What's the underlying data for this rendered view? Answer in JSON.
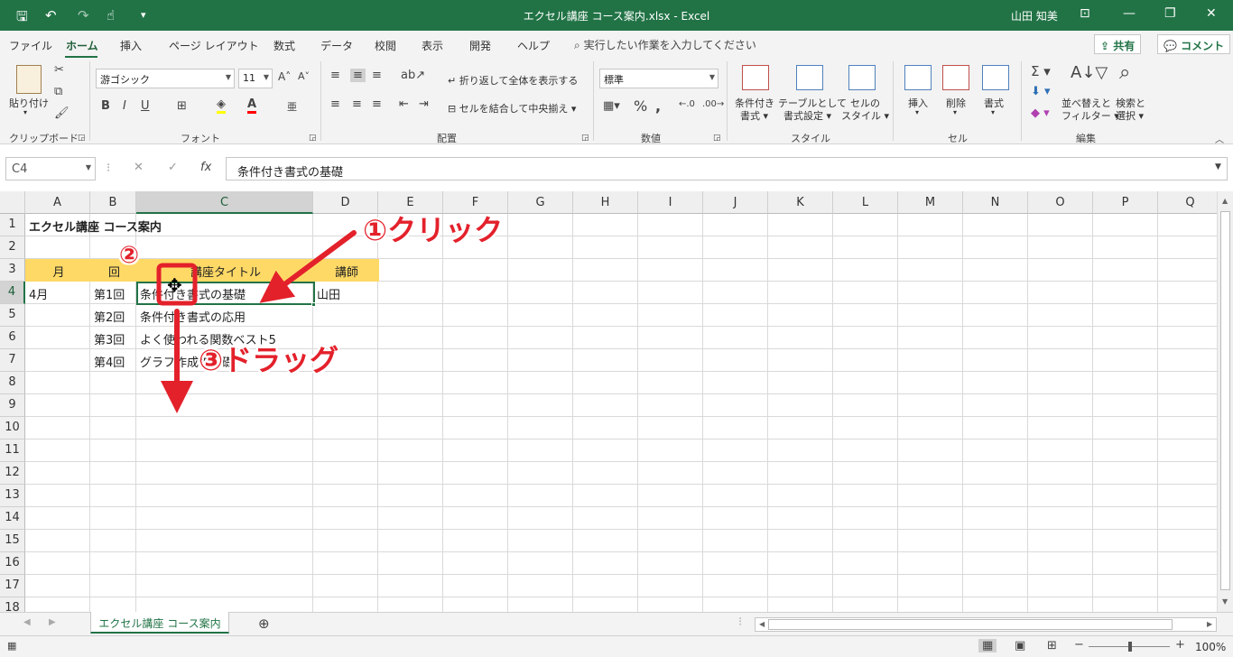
{
  "titlebar": {
    "title": "エクセル講座 コース案内.xlsx  -  Excel",
    "user": "山田 知美"
  },
  "tabs": [
    "ファイル",
    "ホーム",
    "挿入",
    "ページ レイアウト",
    "数式",
    "データ",
    "校閲",
    "表示",
    "開発",
    "ヘルプ"
  ],
  "active_tab": "ホーム",
  "tell_me": "実行したい作業を入力してください",
  "share_label": "共有",
  "comment_label": "コメント",
  "ribbon": {
    "paste": "貼り付け",
    "font_name": "游ゴシック",
    "font_size": "11",
    "wrap_text": "折り返して全体を表示する",
    "merge_center": "セルを結合して中央揃え",
    "number_format": "標準",
    "cond_format": [
      "条件付き",
      "書式"
    ],
    "table_format": [
      "テーブルとして",
      "書式設定"
    ],
    "cell_styles": [
      "セルの",
      "スタイル"
    ],
    "insert": "挿入",
    "delete": "削除",
    "format": "書式",
    "sort_filter": [
      "並べ替えと",
      "フィルター"
    ],
    "find_select": [
      "検索と",
      "選択"
    ],
    "groups": [
      "クリップボード",
      "フォント",
      "配置",
      "数値",
      "スタイル",
      "セル",
      "編集"
    ]
  },
  "formula_bar": {
    "name_box": "C4",
    "formula": "条件付き書式の基礎"
  },
  "columns": [
    "A",
    "B",
    "C",
    "D",
    "E",
    "F",
    "G",
    "H",
    "I",
    "J",
    "K",
    "L",
    "M",
    "N",
    "O",
    "P",
    "Q"
  ],
  "rows": [
    "1",
    "2",
    "3",
    "4",
    "5",
    "6",
    "7",
    "8",
    "9",
    "10",
    "11",
    "12",
    "13",
    "14",
    "15",
    "16",
    "17",
    "18"
  ],
  "cells": {
    "A1": "エクセル講座 コース案内",
    "A3": "月",
    "B3": "回",
    "C3": "講座タイトル",
    "D3": "講師",
    "A4": "4月",
    "B4": "第1回",
    "C4": "条件付き書式の基礎",
    "D4": "山田",
    "B5": "第2回",
    "C5": "条件付き書式の応用",
    "B6": "第3回",
    "C6": "よく使われる関数ベスト5",
    "B7": "第4回",
    "C7": "グラフ作成の基礎"
  },
  "header_fill": "#ffd966",
  "accent": "#217346",
  "sheet_tab": "エクセル講座 コース案内",
  "zoom": "100%",
  "annotations": {
    "step1": "①クリック",
    "step2": "②",
    "step3": "③ドラッグ",
    "color": "#e3212b"
  }
}
